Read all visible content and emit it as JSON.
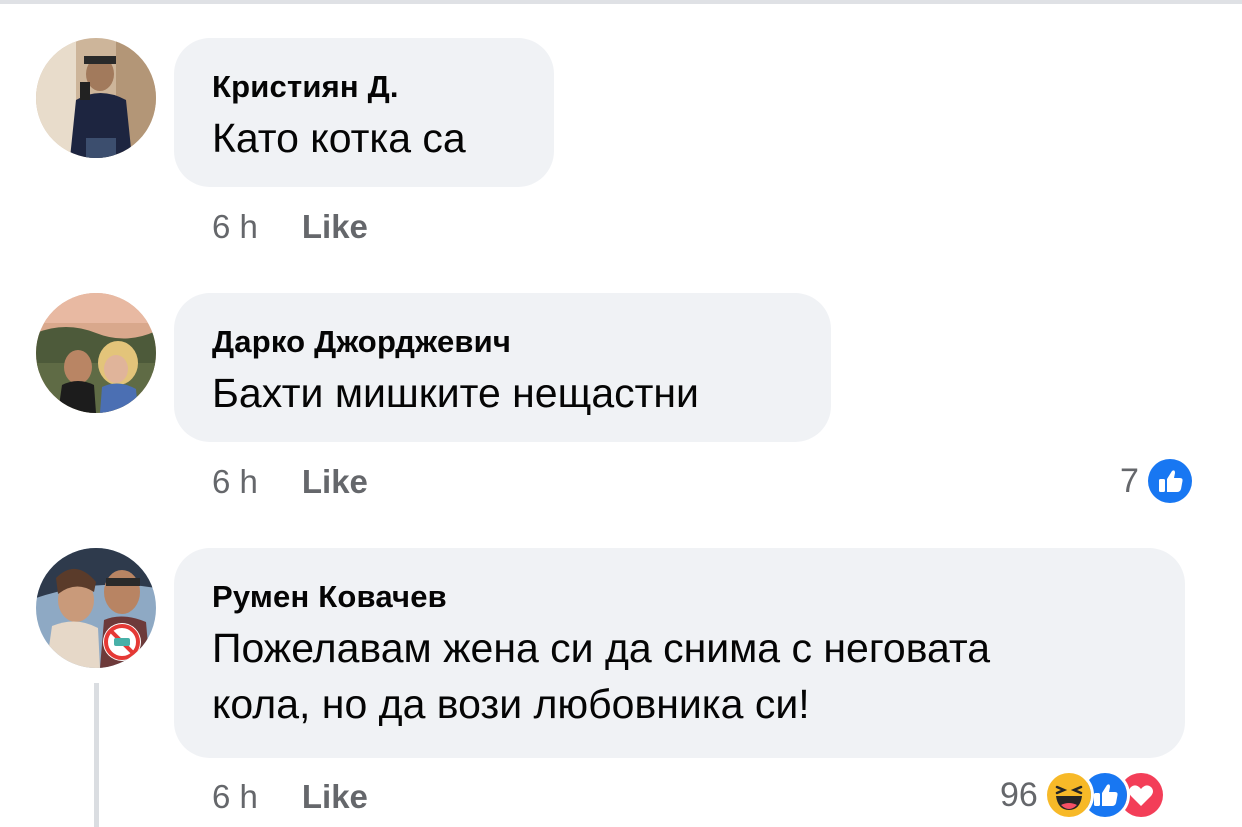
{
  "comments": [
    {
      "author": "Кристиян Д.",
      "text": "Като котка са",
      "time": "6 h",
      "like_label": "Like",
      "reactions": null
    },
    {
      "author": "Дарко Джорджевич",
      "text": "Бахти мишките нещастни",
      "time": "6 h",
      "like_label": "Like",
      "reactions": {
        "count": "7",
        "icons": [
          "like-reaction-icon"
        ]
      }
    },
    {
      "author": "Румен Ковачев",
      "text_line1": "Пожелавам жена си да снима с неговата",
      "text_line2": "кола, но да вози любовника си!",
      "time": "6 h",
      "like_label": "Like",
      "reactions": {
        "count": "96",
        "icons": [
          "haha-reaction-icon",
          "like-reaction-icon",
          "love-reaction-icon"
        ]
      }
    }
  ],
  "colors": {
    "bubble": "#f0f2f5",
    "text": "#050505",
    "meta": "#65676b",
    "like_blue": "#1877f2",
    "love_red": "#f33e58",
    "haha_yellow": "#f7b928"
  }
}
